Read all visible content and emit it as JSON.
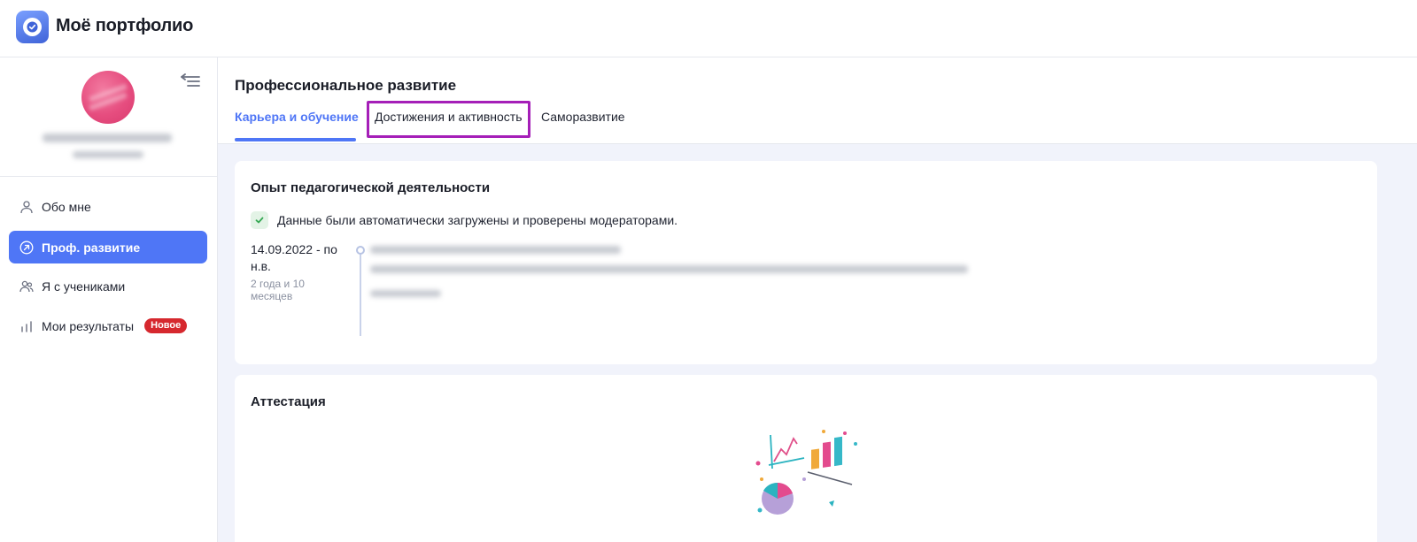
{
  "app": {
    "title": "Моё портфолио"
  },
  "sidebar": {
    "items": [
      {
        "label": "Обо мне",
        "icon": "user-icon",
        "active": false
      },
      {
        "label": "Проф. развитие",
        "icon": "arrow-up-right-circle-icon",
        "active": true
      },
      {
        "label": "Я с учениками",
        "icon": "users-icon",
        "active": false
      },
      {
        "label": "Мои результаты",
        "icon": "bar-chart-icon",
        "active": false,
        "badge": "Новое"
      }
    ]
  },
  "main": {
    "title": "Профессиональное развитие",
    "tabs": [
      {
        "label": "Карьера и обучение",
        "active": true
      },
      {
        "label": "Достижения и активность",
        "active": false
      },
      {
        "label": "Саморазвитие",
        "active": false
      }
    ]
  },
  "experience": {
    "title": "Опыт педагогической деятельности",
    "verified_text": "Данные были автоматически загружены и проверены модераторами.",
    "period": "14.09.2022 - по н.в.",
    "duration": "2 года и 10 месяцев"
  },
  "attestation": {
    "title": "Аттестация"
  },
  "colors": {
    "accent": "#4f76f6",
    "badge": "#d6282e",
    "highlight": "#a51fb8",
    "avatar": "#e64d7f"
  }
}
